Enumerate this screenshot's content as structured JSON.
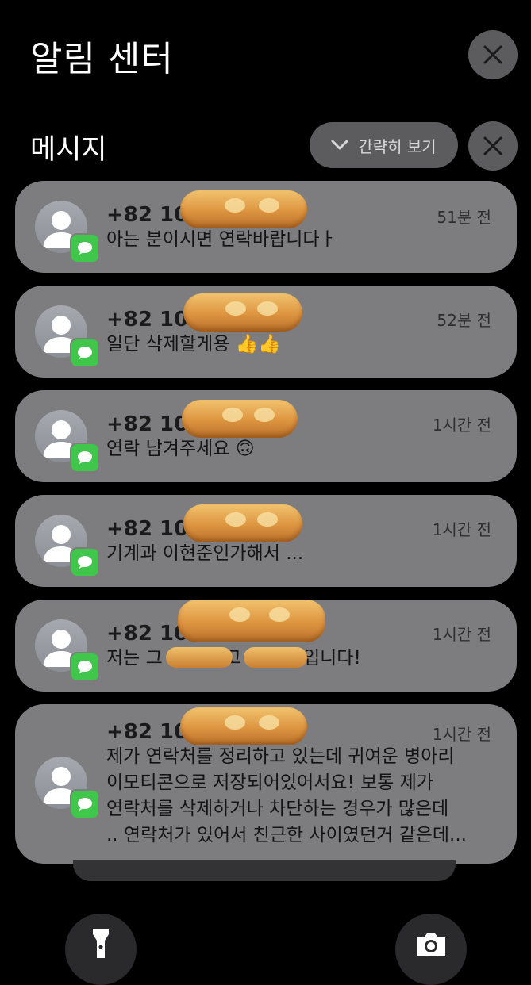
{
  "header": {
    "title": "알림 센터"
  },
  "section": {
    "title": "메시지",
    "collapse_label": "간략히 보기"
  },
  "notifications": [
    {
      "sender": "+82 10-",
      "time": "51분 전",
      "lines": [
        "아는 분이시면 연락바랍니다ㅏ"
      ]
    },
    {
      "sender": "+82 10-",
      "time": "52분 전",
      "lines": [
        "일단 삭제할게용 👍👍"
      ]
    },
    {
      "sender": "+82 10-",
      "time": "1시간 전",
      "lines": [
        "연락 남겨주세요 🙃"
      ]
    },
    {
      "sender": "+82 10-",
      "time": "1시간 전",
      "lines": [
        "기계과 이현준인가해서 ..."
      ]
    },
    {
      "sender": "+82 10-",
      "time": "1시간 전",
      "lines": [
        "저는 그",
        "고",
        "입니다!"
      ]
    },
    {
      "sender": "+82 10-",
      "time": "1시간 전",
      "lines": [
        "제가 연락처를 정리하고 있는데 귀여운 병아리",
        "이모티콘으로 저장되어있어서요! 보통 제가",
        "연락처를 삭제하거나 차단하는 경우가 많은데",
        ".. 연락처가 있어서 친근한 사이였던거 같은데..."
      ]
    }
  ],
  "icons": {
    "close": "close-icon",
    "chevron": "chevron-down-icon",
    "flashlight": "flashlight-icon",
    "camera": "camera-icon",
    "message": "message-icon",
    "avatar": "contact-avatar-icon"
  },
  "colors": {
    "card": "#7d7d7f",
    "button": "#5c5c5e",
    "badge": "#3fc64b",
    "background": "#000000"
  }
}
